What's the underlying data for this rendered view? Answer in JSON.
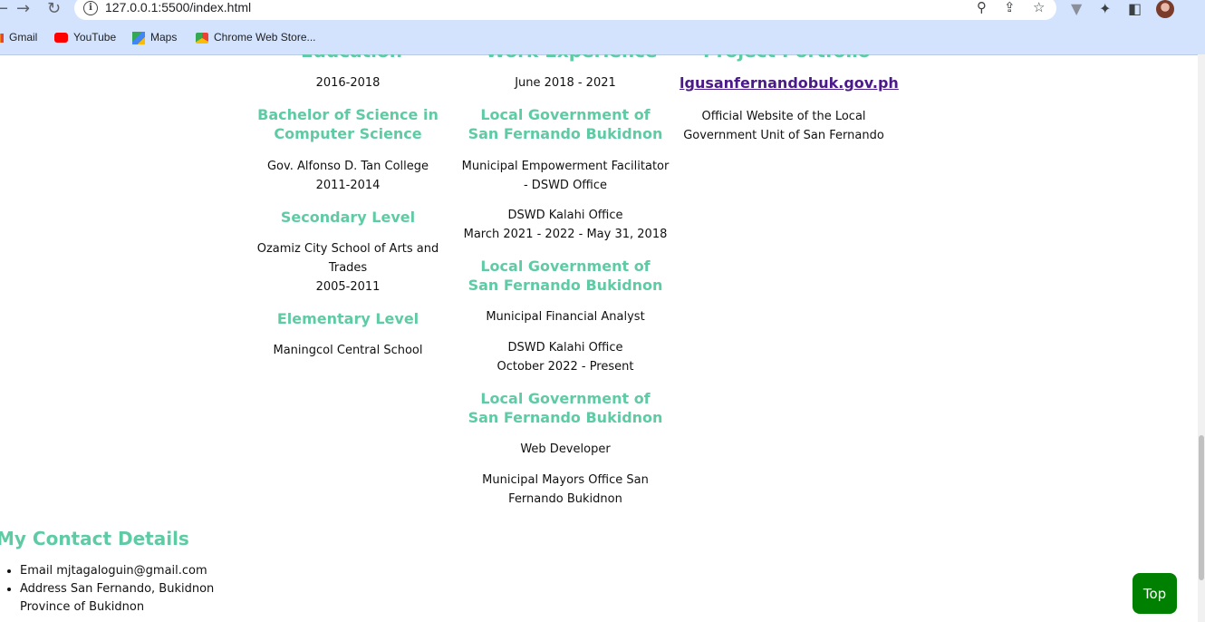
{
  "browser": {
    "url": "127.0.0.1:5500/index.html",
    "bookmarks": [
      "Gmail",
      "YouTube",
      "Maps",
      "Chrome Web Store..."
    ]
  },
  "sections": {
    "education_title": "Education",
    "work_title": "Work Experience",
    "projects_title": "Project Portfolio"
  },
  "education": {
    "top_year": "2016-2018",
    "items": [
      {
        "title": "Bachelor of Science in Computer Science",
        "school": "Gov. Alfonso D. Tan College",
        "years": "2011-2014"
      },
      {
        "title": "Secondary Level",
        "school": "Ozamiz City School of Arts and Trades",
        "years": "2005-2011"
      },
      {
        "title": "Elementary Level",
        "school": "Maningcol Central School",
        "years": ""
      }
    ]
  },
  "work": {
    "top_date": "June 2018 - 2021",
    "items": [
      {
        "org": "Local Government of San Fernando Bukidnon",
        "role": "Municipal Empowerment Facilitator - DSWD Office",
        "office": "DSWD Kalahi Office",
        "dates": "March 2021 - 2022 - May 31, 2018"
      },
      {
        "org": "Local Government of San Fernando Bukidnon",
        "role": "Municipal Financial Analyst",
        "office": "DSWD Kalahi Office",
        "dates": "October 2022 - Present"
      },
      {
        "org": "Local Government of San Fernando Bukidnon",
        "role": "Web Developer",
        "office": "Municipal Mayors Office San Fernando Bukidnon",
        "dates": ""
      }
    ]
  },
  "projects": {
    "link": "lgusanfernandobuk.gov.ph",
    "description": "Official Website of the Local Government Unit of San Fernando"
  },
  "contact": {
    "title": "My Contact Details",
    "email": "Email mjtagaloguin@gmail.com",
    "address": "Address San Fernando, Bukidnon Province of Bukidnon"
  },
  "top_button": "Top",
  "colors": {
    "accent": "#5fcba5",
    "top_button": "#008000",
    "link": "#4b1a8a"
  }
}
